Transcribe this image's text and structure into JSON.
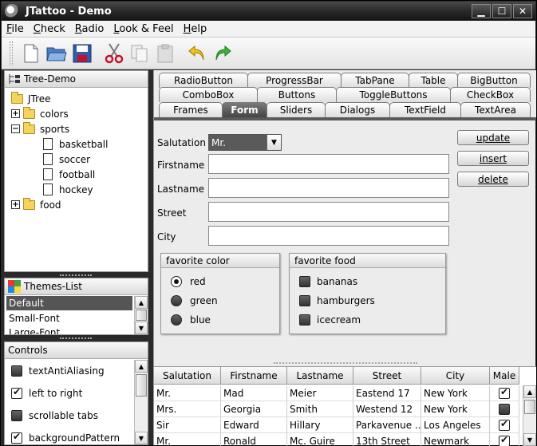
{
  "window": {
    "title": "JTattoo - Demo"
  },
  "menu": [
    {
      "label": "File",
      "u": "F",
      "rest": "ile"
    },
    {
      "label": "Check",
      "u": "C",
      "rest": "heck"
    },
    {
      "label": "Radio",
      "u": "R",
      "rest": "adio"
    },
    {
      "label": "Look & Feel",
      "u": "L",
      "rest": "ook & Feel"
    },
    {
      "label": "Help",
      "u": "H",
      "rest": "elp"
    }
  ],
  "toolbar_icons": [
    "new-file-icon",
    "open-folder-icon",
    "save-icon",
    "cut-icon",
    "copy-icon",
    "paste-icon",
    "undo-icon",
    "redo-icon"
  ],
  "tree": {
    "title": "Tree-Demo",
    "root": "JTree",
    "nodes": [
      {
        "label": "colors",
        "expanded": false
      },
      {
        "label": "sports",
        "expanded": true,
        "children": [
          "basketball",
          "soccer",
          "football",
          "hockey"
        ]
      },
      {
        "label": "food",
        "expanded": false
      }
    ]
  },
  "themes": {
    "title": "Themes-List",
    "items": [
      "Default",
      "Small-Font",
      "Large-Font"
    ],
    "selected": "Default"
  },
  "controls": {
    "title": "Controls",
    "items": [
      {
        "label": "textAntiAliasing",
        "checked": false
      },
      {
        "label": "left to right",
        "checked": true
      },
      {
        "label": "scrollable tabs",
        "checked": false
      },
      {
        "label": "backgroundPattern",
        "checked": true
      }
    ]
  },
  "tabs": {
    "row1": [
      "RadioButton",
      "ProgressBar",
      "TabPane",
      "Table",
      "BigButton"
    ],
    "row2": [
      "ComboBox",
      "Buttons",
      "ToggleButtons",
      "CheckBox"
    ],
    "row3": [
      "Frames",
      "Form",
      "Sliders",
      "Dialogs",
      "TextField",
      "TextArea"
    ],
    "active": "Form"
  },
  "form": {
    "salutation_label": "Salutation",
    "salutation_value": "Mr.",
    "firstname_label": "Firstname",
    "lastname_label": "Lastname",
    "street_label": "Street",
    "city_label": "City",
    "buttons": {
      "update": "update",
      "insert": "insert",
      "delete": "delete"
    },
    "favorite_color": {
      "title": "favorite color",
      "options": [
        {
          "label": "red",
          "selected": true
        },
        {
          "label": "green",
          "selected": false
        },
        {
          "label": "blue",
          "selected": false
        }
      ]
    },
    "favorite_food": {
      "title": "favorite food",
      "options": [
        {
          "label": "bananas",
          "checked": false
        },
        {
          "label": "hamburgers",
          "checked": false
        },
        {
          "label": "icecream",
          "checked": false
        }
      ]
    }
  },
  "table": {
    "columns": [
      "Salutation",
      "Firstname",
      "Lastname",
      "Street",
      "City",
      "Male"
    ],
    "rows": [
      [
        "Mr.",
        "Mad",
        "Meier",
        "Eastend 17",
        "New York",
        true
      ],
      [
        "Mrs.",
        "Georgia",
        "Smith",
        "Westend 12",
        "New York",
        false
      ],
      [
        "Sir",
        "Edward",
        "Hillary",
        "Parkavenue ...",
        "Los Angeles",
        true
      ],
      [
        "Mr.",
        "Ronald",
        "Mc. Guire",
        "13th Street",
        "Newmark",
        true
      ]
    ]
  }
}
